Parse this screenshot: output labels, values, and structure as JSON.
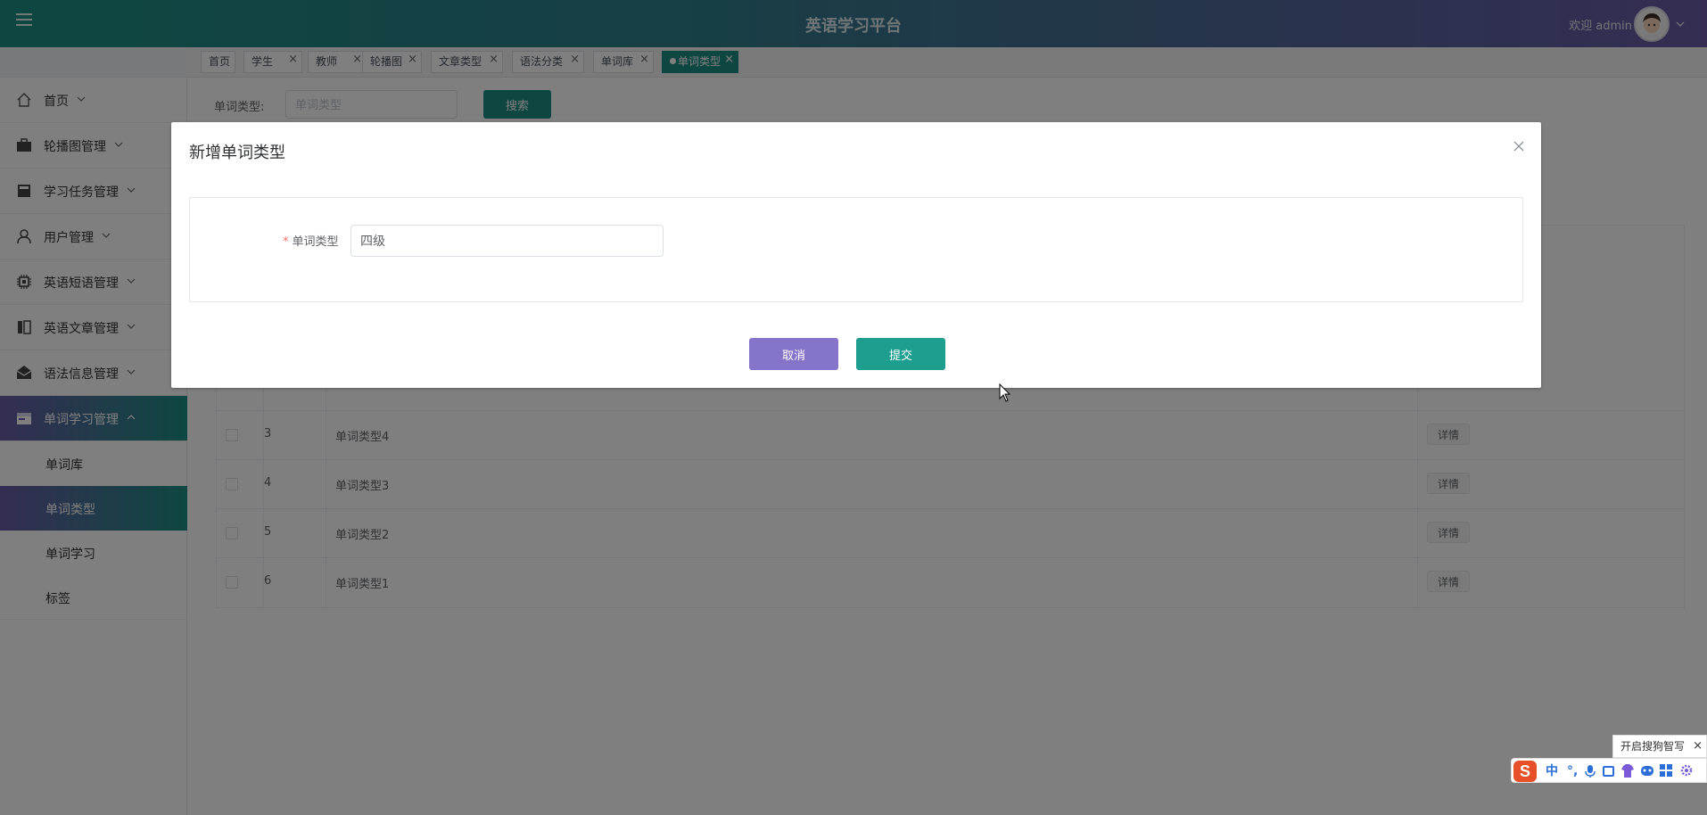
{
  "header": {
    "title": "英语学习平台",
    "welcome": "欢迎 admin"
  },
  "tabs": [
    {
      "label": "首页",
      "closable": false,
      "active": false
    },
    {
      "label": "学生",
      "closable": true,
      "active": false
    },
    {
      "label": "教师",
      "closable": true,
      "active": false
    },
    {
      "label": "轮播图",
      "closable": true,
      "active": false
    },
    {
      "label": "文章类型",
      "closable": true,
      "active": false
    },
    {
      "label": "语法分类",
      "closable": true,
      "active": false
    },
    {
      "label": "单词库",
      "closable": true,
      "active": false
    },
    {
      "label": "单词类型",
      "closable": true,
      "active": true
    }
  ],
  "sidebar": {
    "items": [
      {
        "label": "首页",
        "icon": "home-icon"
      },
      {
        "label": "轮播图管理",
        "icon": "briefcase-icon"
      },
      {
        "label": "学习任务管理",
        "icon": "book-icon"
      },
      {
        "label": "用户管理",
        "icon": "user-icon"
      },
      {
        "label": "英语短语管理",
        "icon": "chip-icon"
      },
      {
        "label": "英语文章管理",
        "icon": "columns-icon"
      },
      {
        "label": "语法信息管理",
        "icon": "mail-icon"
      },
      {
        "label": "单词学习管理",
        "icon": "folder-icon"
      }
    ],
    "subitems": [
      {
        "label": "单词库",
        "active": false
      },
      {
        "label": "单词类型",
        "active": true
      },
      {
        "label": "单词学习",
        "active": false
      },
      {
        "label": "标签",
        "active": false
      }
    ]
  },
  "search": {
    "label": "单词类型:",
    "placeholder": "单词类型",
    "button": "搜索"
  },
  "table": {
    "rows": [
      {
        "index": "3",
        "name": "单词类型4",
        "action": "详情"
      },
      {
        "index": "4",
        "name": "单词类型3",
        "action": "详情"
      },
      {
        "index": "5",
        "name": "单词类型2",
        "action": "详情"
      },
      {
        "index": "6",
        "name": "单词类型1",
        "action": "详情"
      }
    ]
  },
  "dialog": {
    "title": "新增单词类型",
    "field_label": "单词类型",
    "field_value": "四级",
    "cancel": "取消",
    "submit": "提交"
  },
  "ime": {
    "tip": "开启搜狗智写",
    "logo": "S",
    "lang": "中"
  },
  "colors": {
    "primary": "#1d8f84",
    "cancel": "#8574c9",
    "submit": "#1d9e8e",
    "header_start": "#1c8f84",
    "header_end": "#6a5ba6"
  }
}
